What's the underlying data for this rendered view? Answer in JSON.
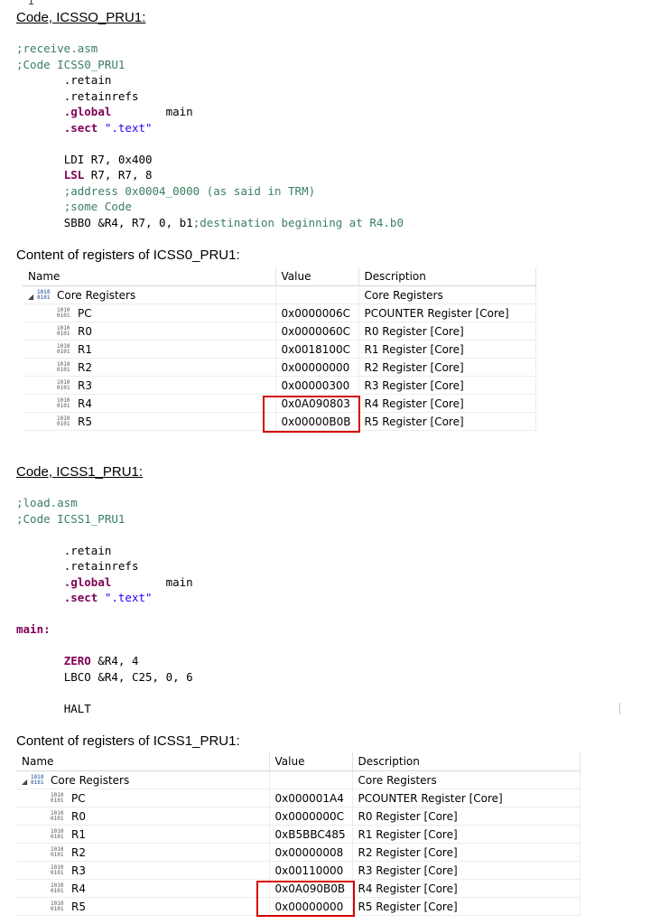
{
  "cursor_glyph": "I",
  "section1": {
    "heading": "Code, ICSSO_PRU1:",
    "code": {
      "c1": ";receive.asm",
      "c2": ";Code ICSS0_PRU1",
      "retain": ".retain",
      "retainrefs": ".retainrefs",
      "global_kw": ".global",
      "global_arg": "main",
      "sect_kw": ".sect",
      "sect_arg": "\".text\"",
      "ldi": "LDI R7, 0x400",
      "lsl_kw": "LSL",
      "lsl_args": " R7, R7, 8",
      "c3": ";address 0x0004_0000 (as said in TRM)",
      "c4": ";some Code",
      "sbbo": "SBBO &R4, R7, 0, b1",
      "sbbo_comment": ";destination beginning at R4.b0"
    },
    "table_title": "Content of registers of ICSS0_PRU1:",
    "columns": [
      "Name",
      "Value",
      "Description"
    ],
    "group": {
      "name": "Core Registers",
      "description": "Core Registers"
    },
    "rows": [
      {
        "name": "PC",
        "value": "0x0000006C",
        "description": "PCOUNTER Register [Core]"
      },
      {
        "name": "R0",
        "value": "0x0000060C",
        "description": "R0 Register [Core]"
      },
      {
        "name": "R1",
        "value": "0x0018100C",
        "description": "R1 Register [Core]"
      },
      {
        "name": "R2",
        "value": "0x00000000",
        "description": "R2 Register [Core]"
      },
      {
        "name": "R3",
        "value": "0x00000300",
        "description": "R3 Register [Core]"
      },
      {
        "name": "R4",
        "value": "0x0A090803",
        "description": "R4 Register [Core]"
      },
      {
        "name": "R5",
        "value": "0x00000B0B",
        "description": "R5 Register [Core]"
      }
    ]
  },
  "section2": {
    "heading": "Code, ICSS1_PRU1:",
    "code": {
      "c1": ";load.asm",
      "c2": ";Code ICSS1_PRU1",
      "retain": ".retain",
      "retainrefs": ".retainrefs",
      "global_kw": ".global",
      "global_arg": "main",
      "sect_kw": ".sect",
      "sect_arg": "\".text\"",
      "label": "main:",
      "zero_kw": "ZERO",
      "zero_args": " &R4, 4",
      "lbco": "LBCO &R4, C25, 0, 6",
      "halt": "HALT"
    },
    "table_title": "Content of registers of ICSS1_PRU1:",
    "columns": [
      "Name",
      "Value",
      "Description"
    ],
    "group": {
      "name": "Core Registers",
      "description": "Core Registers"
    },
    "rows": [
      {
        "name": "PC",
        "value": "0x000001A4",
        "description": "PCOUNTER Register [Core]"
      },
      {
        "name": "R0",
        "value": "0x0000000C",
        "description": "R0 Register [Core]"
      },
      {
        "name": "R1",
        "value": "0xB5BBC485",
        "description": "R1 Register [Core]"
      },
      {
        "name": "R2",
        "value": "0x00000008",
        "description": "R2 Register [Core]"
      },
      {
        "name": "R3",
        "value": "0x00110000",
        "description": "R3 Register [Core]"
      },
      {
        "name": "R4",
        "value": "0x0A090B0B",
        "description": "R4 Register [Core]"
      },
      {
        "name": "R5",
        "value": "0x00000000",
        "description": "R5 Register [Core]"
      }
    ]
  },
  "icons": {
    "register": "binary-register-icon",
    "group": "register-group-icon",
    "expand": "expand-triangle-icon"
  },
  "colors": {
    "highlight_box": "#d40000",
    "comment": "#3a7f5f",
    "keyword": "#7f0055",
    "string": "#2a00ff"
  }
}
